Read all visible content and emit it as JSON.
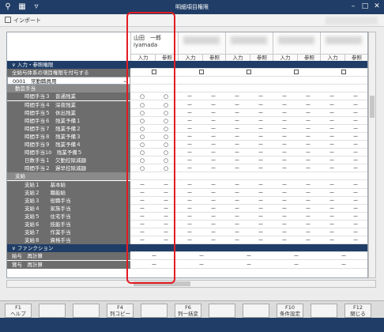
{
  "window": {
    "title": "明細項目権限"
  },
  "toolbar": {
    "import_label": "インポート"
  },
  "users": [
    {
      "name": "山田　一郎",
      "id": "iyamada"
    },
    {
      "name": ""
    },
    {
      "name": ""
    },
    {
      "name": ""
    },
    {
      "name": ""
    },
    {
      "name": ""
    }
  ],
  "sub_headers": {
    "input": "入力",
    "ref": "参照"
  },
  "rows": [
    {
      "type": "section",
      "label": "入力・参照権限"
    },
    {
      "type": "check",
      "label": "全給与体系の項目権限を付与する"
    },
    {
      "type": "select",
      "label": "0001　常勤職員用"
    },
    {
      "type": "group",
      "label": "勤怠手当"
    },
    {
      "type": "item",
      "label": "時間手当３　普通残業",
      "mark": "○"
    },
    {
      "type": "item",
      "label": "時間手当４　深夜残業",
      "mark": "○"
    },
    {
      "type": "item",
      "label": "時間手当５　休出残業",
      "mark": "○"
    },
    {
      "type": "item",
      "label": "時間手当６　残業予備１",
      "mark": "○"
    },
    {
      "type": "item",
      "label": "時間手当７　残業予備２",
      "mark": "○"
    },
    {
      "type": "item",
      "label": "時間手当８　残業予備３",
      "mark": "○"
    },
    {
      "type": "item",
      "label": "時間手当９　残業予備４",
      "mark": "○"
    },
    {
      "type": "item",
      "label": "時間手当10　残業予備５",
      "mark": "○"
    },
    {
      "type": "item",
      "label": "日数手当１　欠勤控除減額",
      "mark": "○"
    },
    {
      "type": "item",
      "label": "時間手当２　遅早控除減額",
      "mark": "○"
    },
    {
      "type": "group",
      "label": "支給"
    },
    {
      "type": "item",
      "label": "支給１　　基本給",
      "mark": "－"
    },
    {
      "type": "item",
      "label": "支給２　　職能給",
      "mark": "－"
    },
    {
      "type": "item",
      "label": "支給３　　役職手当",
      "mark": "－"
    },
    {
      "type": "item",
      "label": "支給４　　家族手当",
      "mark": "－"
    },
    {
      "type": "item",
      "label": "支給５　　住宅手当",
      "mark": "－"
    },
    {
      "type": "item",
      "label": "支給６　　技能手当",
      "mark": "－"
    },
    {
      "type": "item",
      "label": "支給７　　作業手当",
      "mark": "－"
    },
    {
      "type": "item",
      "label": "支給８　　資格手当",
      "mark": "－"
    },
    {
      "type": "section",
      "label": "ファンクション"
    },
    {
      "type": "func",
      "label": "給与　再計算",
      "mark": "－"
    },
    {
      "type": "func",
      "label": "賞与　再計算",
      "mark": "－"
    }
  ],
  "fkeys": [
    {
      "key": "F1",
      "label": "ヘルプ"
    },
    {
      "key": "",
      "label": ""
    },
    {
      "key": "",
      "label": ""
    },
    {
      "key": "F4",
      "label": "列コピー"
    },
    {
      "key": "",
      "label": ""
    },
    {
      "key": "F6",
      "label": "列一括変更"
    },
    {
      "key": "",
      "label": ""
    },
    {
      "key": "",
      "label": ""
    },
    {
      "key": "F10",
      "label": "条件設定"
    },
    {
      "key": "",
      "label": ""
    },
    {
      "key": "F12",
      "label": "閉じる"
    }
  ]
}
